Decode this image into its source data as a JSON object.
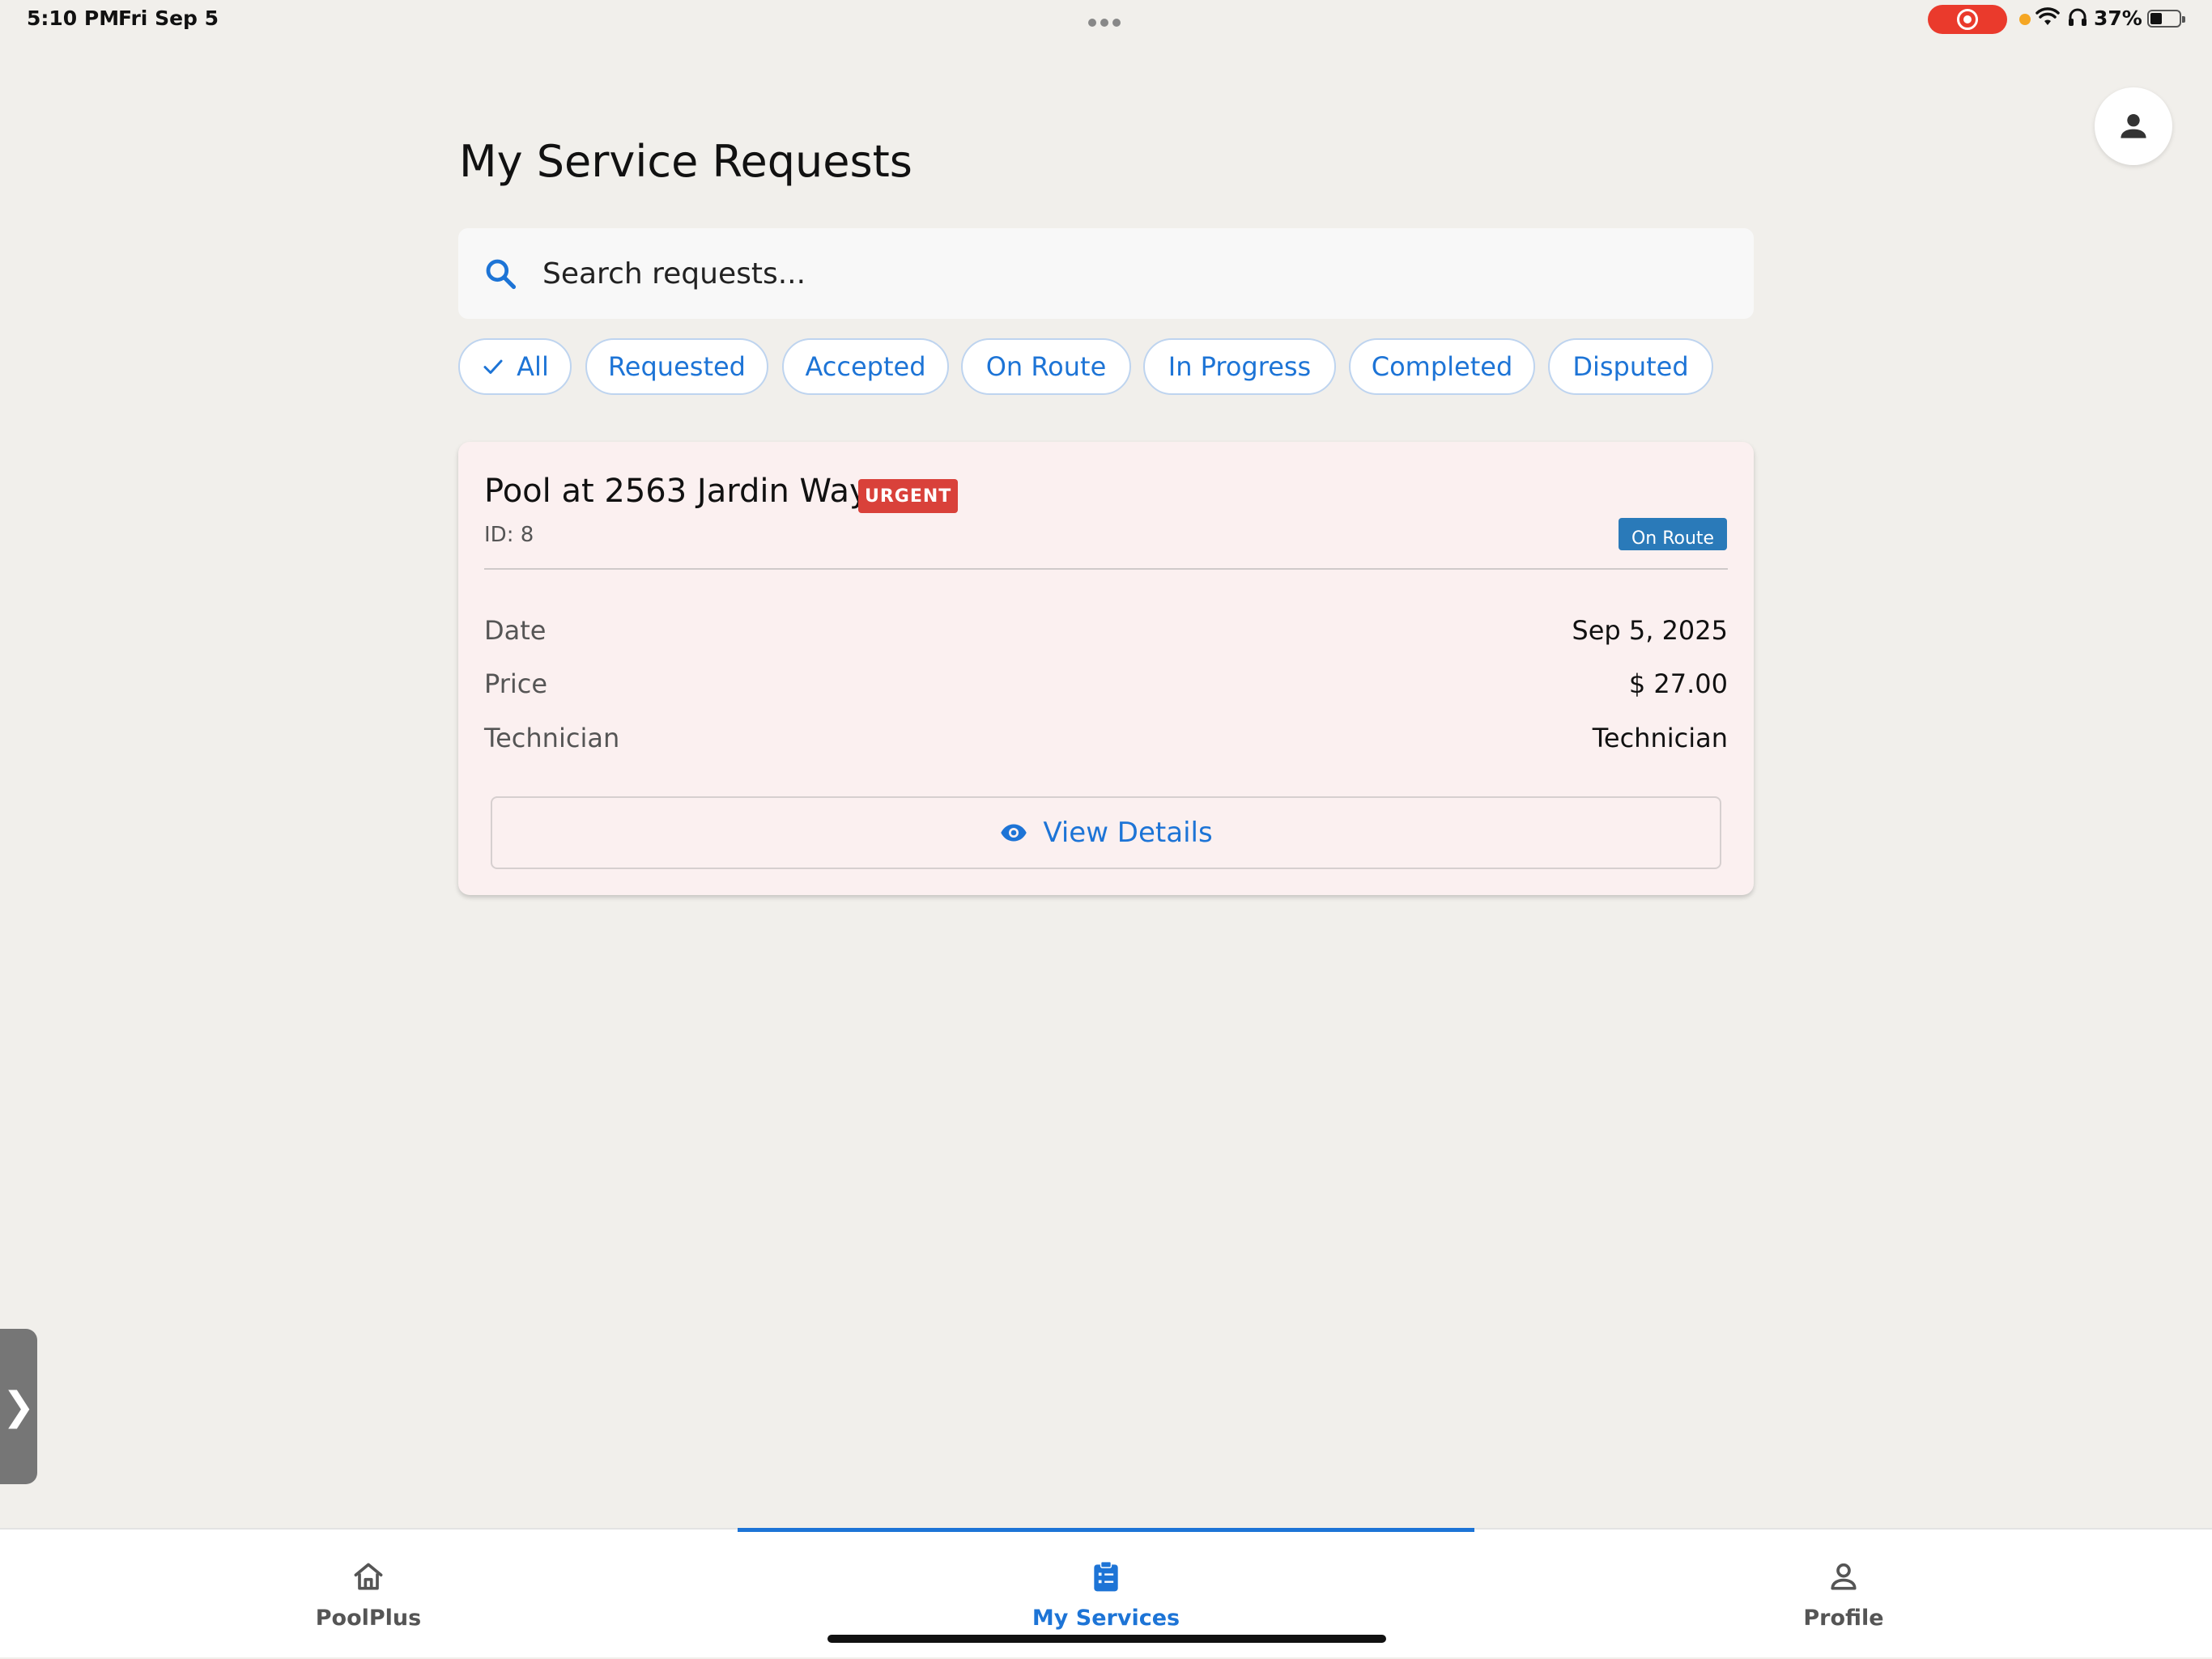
{
  "status_bar": {
    "time": "5:10 PM",
    "date": "Fri Sep 5",
    "battery": "37%"
  },
  "page": {
    "title": "My Service Requests"
  },
  "search": {
    "placeholder": "Search requests..."
  },
  "filters": [
    {
      "label": "All",
      "selected": true
    },
    {
      "label": "Requested",
      "selected": false
    },
    {
      "label": "Accepted",
      "selected": false
    },
    {
      "label": "On Route",
      "selected": false
    },
    {
      "label": "In Progress",
      "selected": false
    },
    {
      "label": "Completed",
      "selected": false
    },
    {
      "label": "Disputed",
      "selected": false
    }
  ],
  "request": {
    "title": "Pool at 2563 Jardin Way",
    "urgent_label": "URGENT",
    "id": "ID: 8",
    "status": "On Route",
    "rows": [
      {
        "label": "Date",
        "value": "Sep 5, 2025"
      },
      {
        "label": "Price",
        "value": "$ 27.00"
      },
      {
        "label": "Technician",
        "value": "Technician"
      }
    ],
    "details_label": "View Details"
  },
  "bottom_nav": [
    {
      "label": "PoolPlus",
      "icon": "home-icon",
      "active": false
    },
    {
      "label": "My Services",
      "icon": "clipboard-list-icon",
      "active": true
    },
    {
      "label": "Profile",
      "icon": "person-icon",
      "active": false
    }
  ],
  "colors": {
    "accent": "#1d74d6",
    "urgent": "#d9413a",
    "status_on_route": "#2a7ab9",
    "card_bg": "#fbf0f0",
    "page_bg": "#f1efeb"
  }
}
